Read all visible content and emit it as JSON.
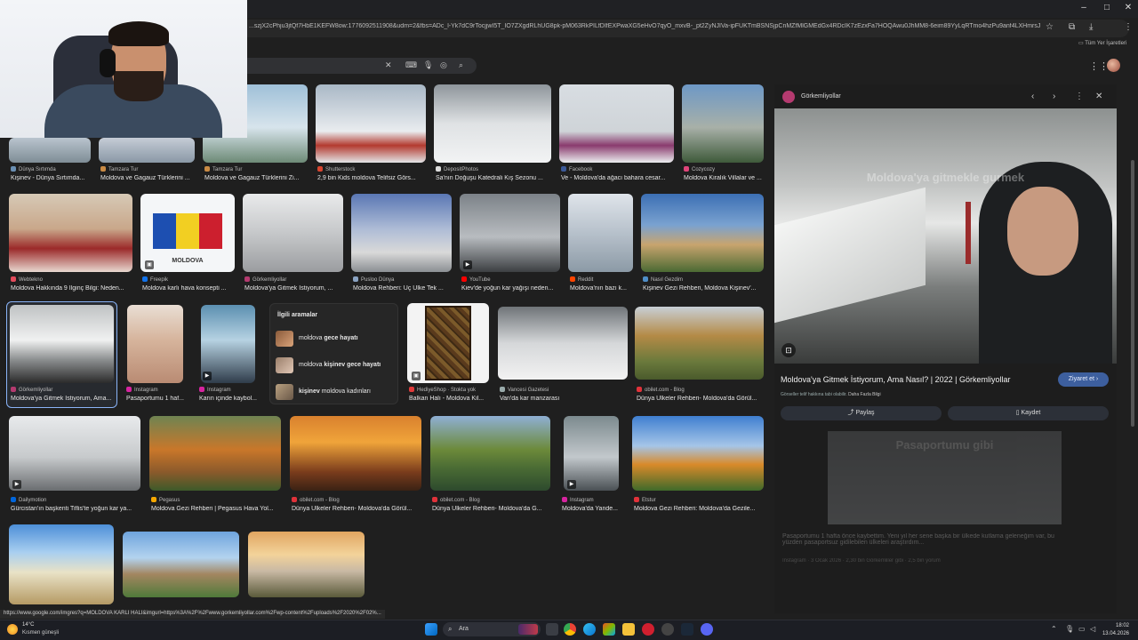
{
  "browser": {
    "url": "...szjX2cPhju3jtQf7HbE1KEFW8ow:1776092511908&udm=2&fbs=ADc_l-Yk7dC9rTocjjwI5T_IO7ZXgdRLhUG8pk-pM063RkPILfDIfEXPwaXG5eHvO7qyO_mxvB-_pt2ZyNJIVa-ipFUKTmBSNSjpCnMZfMlGMEdGx4RDcIK7zEzxFa7HOQAwu0JhMM8-6eim89YyLqRTmo4hzPu9anf4LXHmrsJj5yhDOG0Ne...",
    "bookmarks_label": "Tüm Yer İşaretleri",
    "status_url": "https://www.google.com/imgres?q=MOLDOVA KARLI HALI&imgurl=https%3A%2F%2Fwww.gorkemliyollar.com%2Fwp-content%2Fuploads%2F2020%2F02%..."
  },
  "grid": {
    "row1": [
      {
        "source": "Dünya Sırtımda",
        "caption": "Kişinev - Dünya Sırtımda..."
      },
      {
        "source": "Tamzara Tur",
        "caption": "Moldova ve Gagauz Türklerini ..."
      },
      {
        "source": "Tamzara Tur",
        "caption": "Moldova ve Gagauz Türklerini Zi..."
      },
      {
        "source": "Shutterstock",
        "caption": "2,9 bin Kids moldova Telifsiz Görs..."
      },
      {
        "source": "DepositPhotos",
        "caption": "Sa'nın Doğuşu Katedrali Kış Sezonu ..."
      },
      {
        "source": "Facebook",
        "caption": "Ve - Moldova'da ağacı bahara cesar..."
      },
      {
        "source": "Cozycozy",
        "caption": "Moldova Kiralık Villalar ve ..."
      }
    ],
    "row2": [
      {
        "source": "Webtekno",
        "caption": "Moldova Hakkında 9 İlginç Bilgi: Neden..."
      },
      {
        "source": "Freepik",
        "caption": "Moldova karlı hava konsepti ...",
        "overlay_text": "MOLDOVA"
      },
      {
        "source": "Görkemliyollar",
        "caption": "Moldova'ya Gitmek İstiyorum, ..."
      },
      {
        "source": "Pusloo Dünya",
        "caption": "Moldova Rehberi: Üç Ülke Tek ..."
      },
      {
        "source": "YouTube",
        "caption": "Kiev'de yoğun kar yağışı neden..."
      },
      {
        "source": "Reddit",
        "caption": "Moldova'nın bazı k..."
      },
      {
        "source": "Nasıl Gezdim",
        "caption": "Kişinev Gezi Rehberi, Moldova Kişinev'..."
      }
    ],
    "row3": [
      {
        "source": "Görkemliyollar",
        "caption": "Moldova'ya Gitmek İstiyorum, Ama..."
      },
      {
        "source": "Instagram",
        "caption": "Pasaportumu 1 haf..."
      },
      {
        "source": "Instagram",
        "caption": "Karın içinde kaybol..."
      },
      {
        "source": "HediyeShop · Stokta yok",
        "caption": "Balkan Halı - Moldova Kil..."
      },
      {
        "source": "Vancesi Gazetesi",
        "caption": "Van'da kar manzarası"
      },
      {
        "source": "obilet.com - Blog",
        "caption": "Dünya Ülkeler Rehberi- Moldova'da Görül..."
      }
    ],
    "related": {
      "title": "İlgili aramalar",
      "items": [
        {
          "prefix": "moldova ",
          "bold": "gece hayatı",
          "suffix": ""
        },
        {
          "prefix": "moldova ",
          "bold": "kişinev gece hayatı",
          "suffix": ""
        },
        {
          "prefix": "",
          "bold": "kişinev",
          "suffix": " moldova kadınları"
        }
      ]
    },
    "row4": [
      {
        "source": "Dailymotion",
        "caption": "Gürcistan'ın başkenti Tiflis'te yoğun kar ya..."
      },
      {
        "source": "Pegasus",
        "caption": "Moldova Gezi Rehberi | Pegasus Hava Yol..."
      },
      {
        "source": "obilet.com - Blog",
        "caption": "Dünya Ülkeler Rehberi- Moldova'da Görül..."
      },
      {
        "source": "obilet.com - Blog",
        "caption": "Dünya Ülkeler Rehberi- Moldova'da G..."
      },
      {
        "source": "Instagram",
        "caption": "Moldova'da Yande..."
      },
      {
        "source": "Etstur",
        "caption": "Moldova Gezi Rehberi: Moldova'da Gezile..."
      }
    ]
  },
  "panel": {
    "site": "Görkemliyollar",
    "image_overlay": "Moldova'ya gitmekle gurmek",
    "title": "Moldova'ya Gitmek İstiyorum, Ama Nasıl? | 2022 | Görkemliyollar",
    "visit_label": "Ziyaret et",
    "subtitle_prefix": "Görseller telif hakkına tabi olabilir.",
    "subtitle_link": "Daha Fazla Bilgi",
    "share_label": "Paylaş",
    "save_label": "Kaydet",
    "ghost_overlay": "Pasaportumu gibi",
    "ghost_caption": "Pasaportumu 1 hafta önce kaybettim. Yeni yıl her sene başka bir ülkede kutlama geleneğim var, bu yüzden pasaportsuz gidilebilen ülkeleri araştırdım...",
    "ghost_meta": "Instagram · 3 Ocak 2026 · 2,30 bin Görkemliler gibi · 2,5 bin yorum"
  },
  "taskbar": {
    "weather_temp": "14°C",
    "weather_desc": "Kısmen güneşli",
    "search_label": "Ara",
    "time": "18:02",
    "date": "13.04.2026"
  },
  "colors": {
    "accent": "#8ab4f8",
    "visit_button": "#3d5f9e",
    "background": "#1f1f1f"
  }
}
